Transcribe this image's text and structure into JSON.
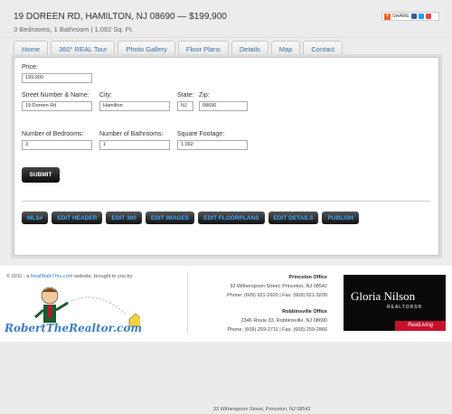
{
  "listing": {
    "title": "19 DOREEN RD, HAMILTON, NJ 08690  —  $199,900",
    "subtitle": "3 Bedrooms, 1 Bathroom   |   1,092 Sq. Ft."
  },
  "share": {
    "label": "SHARE"
  },
  "tabs": [
    {
      "label": "Home"
    },
    {
      "label": "360° REAL Tour"
    },
    {
      "label": "Photo Gallery"
    },
    {
      "label": "Floor Plans"
    },
    {
      "label": "Details"
    },
    {
      "label": "Map"
    },
    {
      "label": "Contact"
    }
  ],
  "form": {
    "price": {
      "label": "Price:",
      "value": "199,900"
    },
    "street": {
      "label": "Street Number & Name:",
      "value": "19 Doreen Rd"
    },
    "city": {
      "label": "City:",
      "value": "Hamilton"
    },
    "state": {
      "label": "State:",
      "value": "NJ"
    },
    "zip": {
      "label": "Zip:",
      "value": "08690"
    },
    "bedrooms": {
      "label": "Number of Bedrooms:",
      "value": "3"
    },
    "bathrooms": {
      "label": "Number of Bathrooms:",
      "value": "1"
    },
    "sqft": {
      "label": "Square Footage:",
      "value": "1,092"
    },
    "submit_label": "SUBMIT"
  },
  "edit_buttons": [
    {
      "label": "MLS#"
    },
    {
      "label": "EDIT HEADER"
    },
    {
      "label": "EDIT 360"
    },
    {
      "label": "EDIT IMAGES"
    },
    {
      "label": "EDIT FLOORPLANS"
    },
    {
      "label": "EDIT DETAILS"
    },
    {
      "label": "PUBLISH"
    }
  ],
  "footer": {
    "copyright_prefix": "© 2011 - a",
    "link_text": "RealWalkThru.com",
    "copyright_suffix": "website, brought to you by:",
    "agent_logo_text": "RobertTheRealtor.com",
    "offices": [
      {
        "name": "Princeton Office",
        "address": "33 Witherspoon Street, Princeton, NJ 08542",
        "phone": "Phone: (609) 921-2600 | Fax: (609) 921-3299"
      },
      {
        "name": "Robbinsville Office",
        "address": "2346 Route 33, Robbinsville, NJ 08690",
        "phone": "Phone: (609) 259-2711 | Fax: (609) 259-2866"
      }
    ],
    "brand": {
      "name": "Gloria Nilson",
      "tagline": "REALTORS®",
      "badge": "RealLiving"
    },
    "cutoff_text": "33 Witherspoon Street, Princeton, NJ 08542"
  }
}
